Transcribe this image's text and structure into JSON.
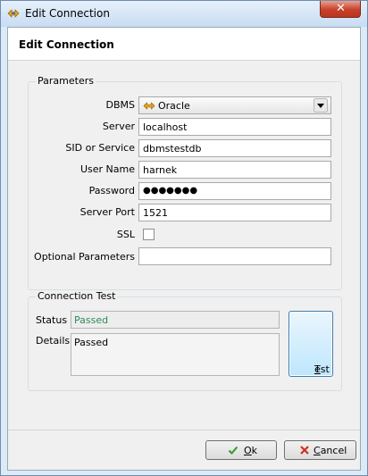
{
  "window": {
    "title": "Edit Connection",
    "close_glyph": "✕"
  },
  "header": {
    "title": "Edit Connection"
  },
  "parameters": {
    "group_label": "Parameters",
    "dbms": {
      "label": "DBMS",
      "value": "Oracle"
    },
    "server": {
      "label": "Server",
      "value": "localhost"
    },
    "sid": {
      "label": "SID or Service",
      "value": "dbmstestdb"
    },
    "user": {
      "label": "User Name",
      "value": "harnek"
    },
    "password": {
      "label": "Password",
      "value": "●●●●●●●"
    },
    "port": {
      "label": "Server Port",
      "value": "1521"
    },
    "ssl": {
      "label": "SSL",
      "checked": false
    },
    "optional": {
      "label": "Optional Parameters",
      "value": ""
    }
  },
  "test": {
    "group_label": "Connection Test",
    "status_label": "Status",
    "status_value": "Passed",
    "details_label": "Details",
    "details_value": "Passed",
    "button_first": "T",
    "button_rest": "est"
  },
  "buttons": {
    "ok_first": "O",
    "ok_rest": "k",
    "cancel_first": "C",
    "cancel_rest": "ancel"
  },
  "colors": {
    "status_passed": "#2e8b57",
    "ok_check": "#2f9a2f",
    "cancel_x": "#d03020"
  }
}
